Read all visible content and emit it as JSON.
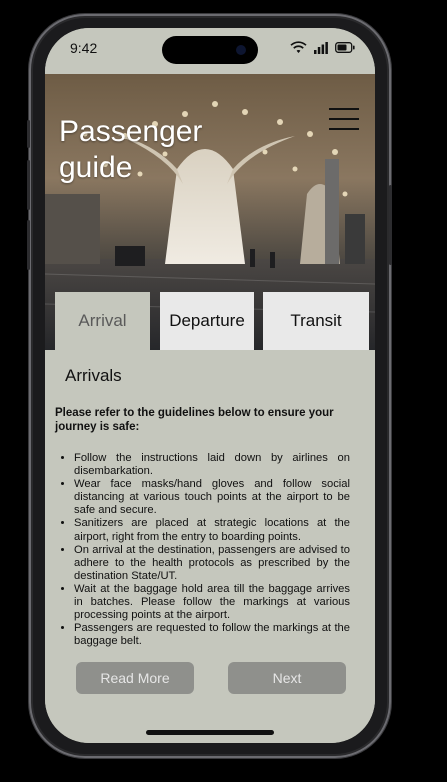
{
  "status_bar": {
    "time": "9:42"
  },
  "header": {
    "title_line1": "Passenger",
    "title_line2": "guide"
  },
  "tabs": [
    {
      "label": "Arrival",
      "active": true
    },
    {
      "label": "Departure",
      "active": false
    },
    {
      "label": "Transit",
      "active": false
    }
  ],
  "content": {
    "section_title": "Arrivals",
    "intro": "Please refer to the guidelines below to ensure your journey is safe:",
    "items": [
      "Follow the instructions laid down by airlines on disembarkation.",
      "Wear face masks/hand gloves and follow social distancing at various touch points at the airport to be safe and secure.",
      "Sanitizers are placed at strategic locations at the airport, right from the entry to boarding points.",
      "On arrival at the destination, passengers are advised to adhere to the health protocols as prescribed by the destination State/UT.",
      "Wait at the baggage hold area till the baggage arrives in batches. Please follow the markings at various processing points at the airport.",
      "Passengers are requested to follow the markings at the baggage belt."
    ]
  },
  "buttons": {
    "read_more": "Read More",
    "next": "Next"
  },
  "colors": {
    "screen_bg": "#c5c7bd",
    "tab_bg": "#e9e9e9",
    "button_bg": "#8f908c"
  },
  "icons": [
    "wifi-icon",
    "signal-icon",
    "battery-icon",
    "hamburger-menu-icon"
  ]
}
